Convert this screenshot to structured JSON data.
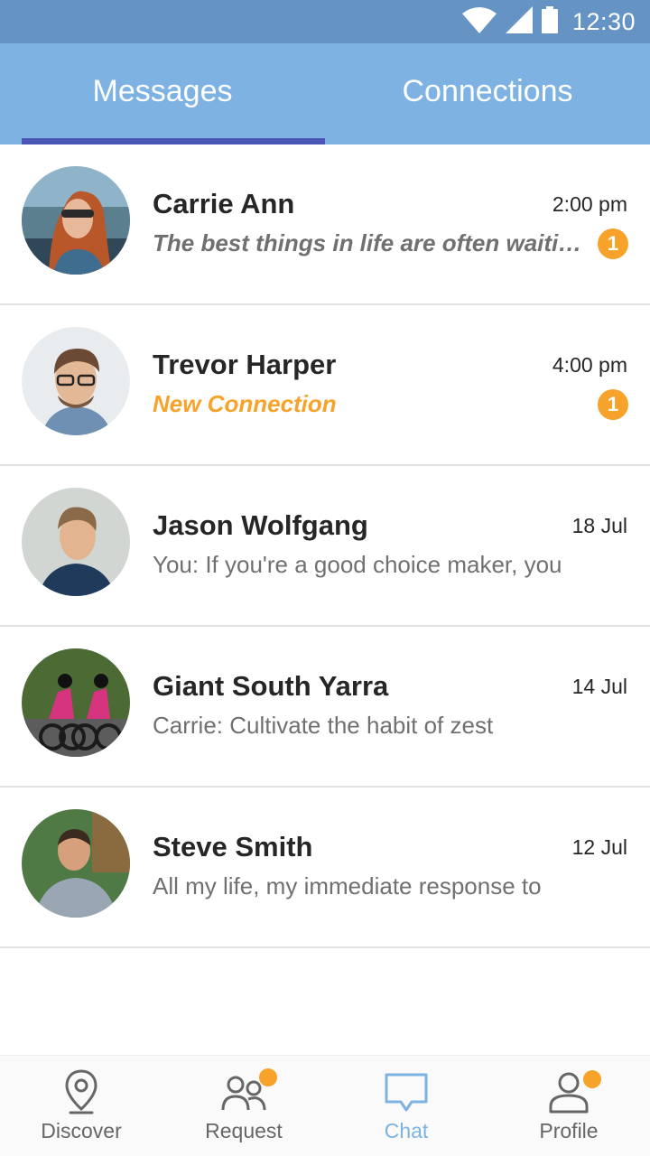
{
  "status_bar": {
    "time": "12:30",
    "icons": [
      "wifi-icon",
      "cell-signal-icon",
      "battery-icon"
    ]
  },
  "tabs": [
    {
      "label": "Messages",
      "active": true
    },
    {
      "label": "Connections",
      "active": false
    }
  ],
  "conversations": [
    {
      "name": "Carrie Ann",
      "time": "2:00 pm",
      "preview": "The best things in life are often waiting for you at the exit ramp",
      "unread": "1"
    },
    {
      "name": "Trevor Harper",
      "time": "4:00 pm",
      "preview": "New Connection",
      "unread": "1"
    },
    {
      "name": "Jason Wolfgang",
      "time": "18 Jul",
      "preview": "You: If you're a good choice maker, you"
    },
    {
      "name": "Giant South Yarra",
      "time": "14 Jul",
      "preview": "Carrie: Cultivate the habit of zest"
    },
    {
      "name": "Steve Smith",
      "time": "12 Jul",
      "preview": "All my life, my immediate response to"
    }
  ],
  "bottom_nav": [
    {
      "label": "Discover",
      "icon": "location-pin-icon",
      "active": false,
      "notification_dot": false
    },
    {
      "label": "Request",
      "icon": "people-icon",
      "active": false,
      "notification_dot": true
    },
    {
      "label": "Chat",
      "icon": "chat-bubble-icon",
      "active": true,
      "notification_dot": false
    },
    {
      "label": "Profile",
      "icon": "person-icon",
      "active": false,
      "notification_dot": true
    }
  ],
  "colors": {
    "status_bar": "#6593c4",
    "tab_bar": "#7db2e3",
    "tab_indicator": "#4b57b5",
    "accent_orange": "#f7a22a",
    "active_nav": "#7db2e3"
  }
}
